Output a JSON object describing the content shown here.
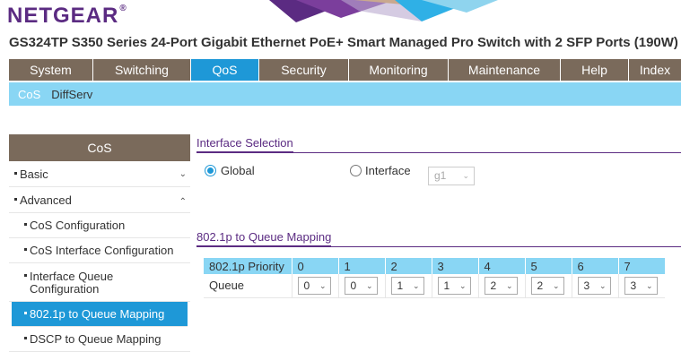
{
  "brand": {
    "name": "NETGEAR",
    "mark": "®"
  },
  "page_title": "GS324TP S350 Series 24-Port Gigabit Ethernet PoE+ Smart Managed Pro Switch with 2 SFP Ports (190W)",
  "nav": {
    "tabs": [
      "System",
      "Switching",
      "QoS",
      "Security",
      "Monitoring",
      "Maintenance",
      "Help",
      "Index"
    ],
    "active": "QoS"
  },
  "subnav": {
    "items": [
      "CoS",
      "DiffServ"
    ],
    "active": "CoS"
  },
  "sidebar": {
    "header": "CoS",
    "basic": "Basic",
    "advanced": "Advanced",
    "items": [
      "CoS Configuration",
      "CoS Interface Configuration",
      "Interface Queue Configuration",
      "802.1p to Queue Mapping",
      "DSCP to Queue Mapping"
    ],
    "active": "802.1p to Queue Mapping"
  },
  "interface_selection": {
    "title": "Interface Selection",
    "global_label": "Global",
    "interface_label": "Interface",
    "interface_value": "g1",
    "selected": "Global"
  },
  "mapping": {
    "title": "802.1p to Queue Mapping",
    "priority_header": "802.1p Priority",
    "queue_label": "Queue",
    "priorities": [
      "0",
      "1",
      "2",
      "3",
      "4",
      "5",
      "6",
      "7"
    ],
    "queues": [
      "0",
      "0",
      "1",
      "1",
      "2",
      "2",
      "3",
      "3"
    ]
  },
  "colors": {
    "brand_purple": "#5b2b82",
    "nav_brown": "#7a6a5b",
    "accent_blue": "#1e98d7",
    "light_blue": "#89d6f4"
  }
}
